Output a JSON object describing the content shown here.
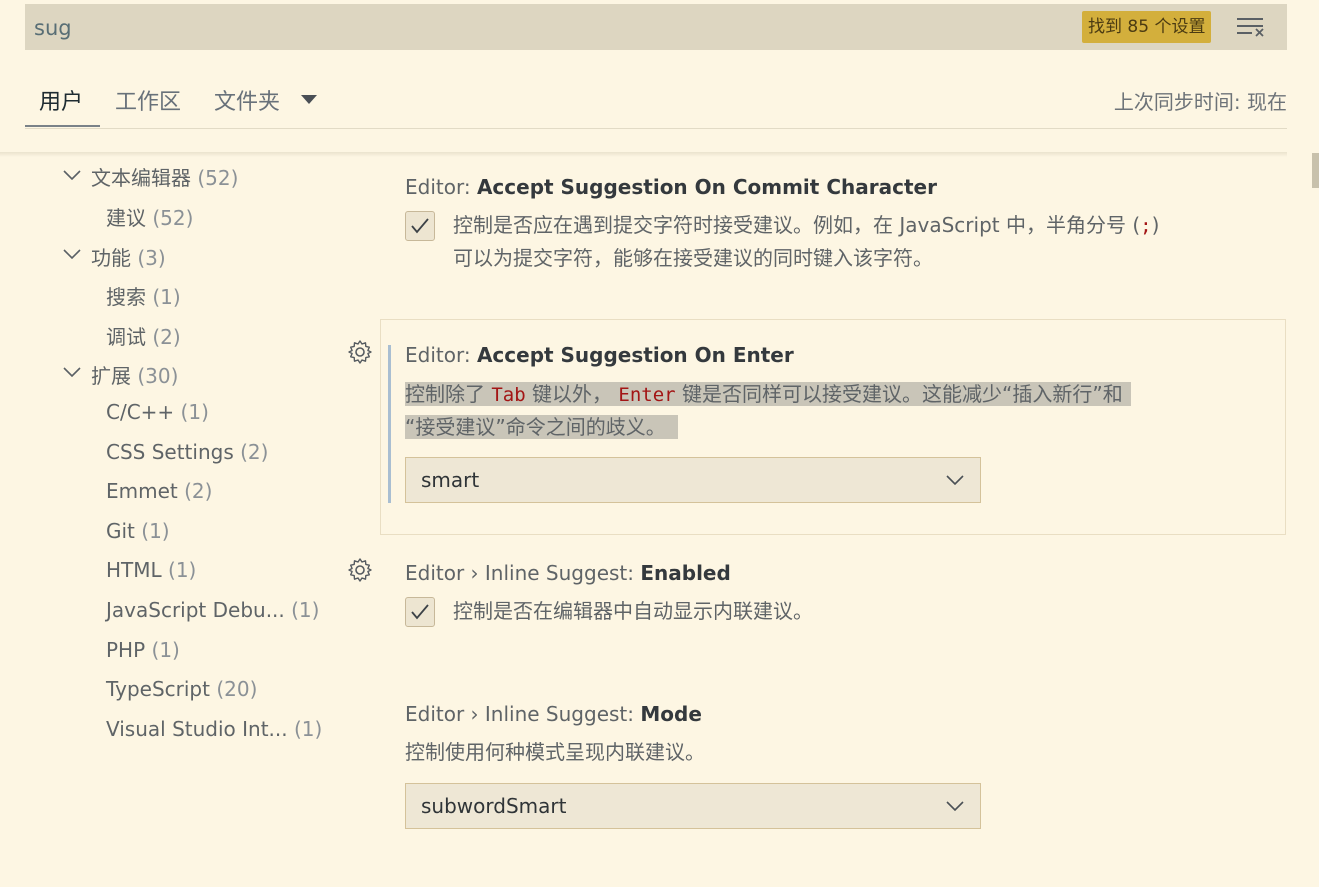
{
  "search": {
    "value": "sug",
    "result_count": "找到 85 个设置"
  },
  "tabs": [
    {
      "label": "用户"
    },
    {
      "label": "工作区"
    },
    {
      "label": "文件夹"
    }
  ],
  "sync_status": "上次同步时间: 现在",
  "toc": [
    {
      "label": "文本编辑器",
      "count": "(52)"
    },
    {
      "label": "建议",
      "count": "(52)"
    },
    {
      "label": "功能",
      "count": "(3)"
    },
    {
      "label": "搜索",
      "count": "(1)"
    },
    {
      "label": "调试",
      "count": "(2)"
    },
    {
      "label": "扩展",
      "count": "(30)"
    },
    {
      "label": "C/C++",
      "count": "(1)"
    },
    {
      "label": "CSS Settings",
      "count": "(2)"
    },
    {
      "label": "Emmet",
      "count": "(2)"
    },
    {
      "label": "Git",
      "count": "(1)"
    },
    {
      "label": "HTML",
      "count": "(1)"
    },
    {
      "label": "JavaScript Debu...",
      "count": "(1)"
    },
    {
      "label": "PHP",
      "count": "(1)"
    },
    {
      "label": "TypeScript",
      "count": "(20)"
    },
    {
      "label": "Visual Studio Int...",
      "count": "(1)"
    }
  ],
  "settings": [
    {
      "category": "Editor: ",
      "name": "Accept Suggestion On Commit Character",
      "desc_line1": "控制是否应在遇到提交字符时接受建议。例如，在 JavaScript 中，半角分号 (",
      "desc_code": ";",
      "desc_line1_end": ")",
      "desc_line2": "可以为提交字符，能够在接受建议的同时键入该字符。"
    },
    {
      "category": "Editor: ",
      "name": "Accept Suggestion On Enter",
      "desc_part1": "控制除了 ",
      "desc_code1": "Tab",
      "desc_part2": " 键以外， ",
      "desc_code2": "Enter",
      "desc_part3": " 键是否同样可以接受建议。这能减少“插入新行”和",
      "desc_line2": "“接受建议”命令之间的歧义。",
      "value": "smart"
    },
    {
      "category": "Editor › Inline Suggest: ",
      "name": "Enabled",
      "desc": "控制是否在编辑器中自动显示内联建议。"
    },
    {
      "category": "Editor › Inline Suggest: ",
      "name": "Mode",
      "desc": "控制使用何种模式呈现内联建议。",
      "value": "subwordSmart"
    }
  ]
}
